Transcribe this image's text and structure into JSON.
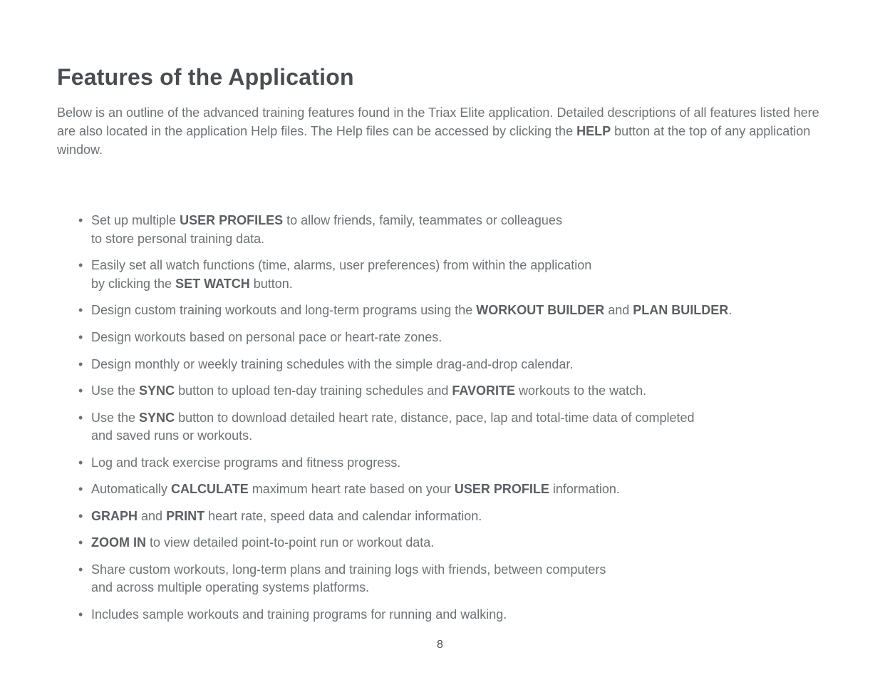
{
  "title": "Features of the Application",
  "intro": [
    {
      "t": "Below is an outline of the advanced training features found in the Triax Elite application. Detailed descriptions of all features listed here are also located in the application Help files. The Help files can be accessed by clicking the "
    },
    {
      "t": "HELP",
      "b": true
    },
    {
      "t": " button at the top of any application window."
    }
  ],
  "bullets": [
    [
      {
        "t": "Set up multiple "
      },
      {
        "t": "USER PROFILES",
        "b": true
      },
      {
        "t": " to allow friends, family, teammates or colleagues\nto store personal training data."
      }
    ],
    [
      {
        "t": "Easily set all watch functions (time, alarms, user preferences) from within the application\nby clicking the "
      },
      {
        "t": "SET WATCH",
        "b": true
      },
      {
        "t": " button."
      }
    ],
    [
      {
        "t": "Design custom training workouts and long-term programs using the "
      },
      {
        "t": "WORKOUT BUILDER",
        "b": true
      },
      {
        "t": " and "
      },
      {
        "t": "PLAN BUILDER",
        "b": true
      },
      {
        "t": "."
      }
    ],
    [
      {
        "t": "Design workouts based on personal pace or heart-rate zones."
      }
    ],
    [
      {
        "t": "Design monthly or weekly training schedules with the simple drag-and-drop calendar."
      }
    ],
    [
      {
        "t": "Use the "
      },
      {
        "t": "SYNC",
        "b": true
      },
      {
        "t": " button to upload ten-day training schedules and "
      },
      {
        "t": "FAVORITE",
        "b": true
      },
      {
        "t": " workouts to the watch."
      }
    ],
    [
      {
        "t": "Use the "
      },
      {
        "t": "SYNC",
        "b": true
      },
      {
        "t": " button to download detailed heart rate, distance, pace, lap and total-time data of completed\nand saved runs or workouts."
      }
    ],
    [
      {
        "t": "Log and track exercise programs and fitness progress."
      }
    ],
    [
      {
        "t": "Automatically "
      },
      {
        "t": "CALCULATE",
        "b": true
      },
      {
        "t": " maximum heart rate based on your "
      },
      {
        "t": "USER PROFILE",
        "b": true
      },
      {
        "t": " information."
      }
    ],
    [
      {
        "t": "GRAPH",
        "b": true
      },
      {
        "t": " and "
      },
      {
        "t": "PRINT",
        "b": true
      },
      {
        "t": " heart rate, speed data and calendar information."
      }
    ],
    [
      {
        "t": "ZOOM IN",
        "b": true
      },
      {
        "t": " to view detailed point-to-point run or workout data."
      }
    ],
    [
      {
        "t": "Share custom workouts, long-term plans and training logs with friends, between computers\nand across multiple operating systems platforms."
      }
    ],
    [
      {
        "t": "Includes sample workouts and training programs for running and walking."
      }
    ]
  ],
  "page_number": "8"
}
